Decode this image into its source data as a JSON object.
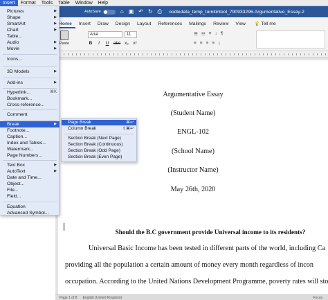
{
  "menubar": {
    "items": [
      "Insert",
      "Format",
      "Tools",
      "Table",
      "Window",
      "Help"
    ]
  },
  "titlebar": {
    "autosave_label": "AutoSave",
    "autosave_state": "OFF",
    "doc_title": "oodledata_temp_turnitintool_790933296.Argumentative_Essay-2"
  },
  "ribbon": {
    "tabs": [
      "Home",
      "Insert",
      "Draw",
      "Design",
      "Layout",
      "References",
      "Mailings",
      "Review",
      "View"
    ],
    "tell_me": "Tell me",
    "paste_label": "Paste",
    "font_name": "Arial",
    "font_size": "11",
    "format_buttons": [
      "B",
      "I",
      "U",
      "abc",
      "x₂",
      "x²"
    ]
  },
  "insert_menu": {
    "items": [
      {
        "label": "Pictures",
        "arrow": true
      },
      {
        "label": "Shape",
        "arrow": true
      },
      {
        "label": "SmartArt",
        "arrow": true
      },
      {
        "label": "Chart",
        "arrow": true
      },
      {
        "label": "Table...",
        "arrow": false
      },
      {
        "label": "Audio",
        "arrow": true
      },
      {
        "label": "Movie",
        "arrow": true
      },
      {
        "label": "Icons...",
        "arrow": false
      },
      {
        "label": "3D Models",
        "arrow": true
      },
      {
        "label": "Add-ins",
        "arrow": true
      },
      {
        "label": "Hyperlink...",
        "shortcut": "⌘K"
      },
      {
        "label": "Bookmark...",
        "arrow": false
      },
      {
        "label": "Cross-reference...",
        "arrow": false
      },
      {
        "label": "Comment",
        "arrow": false
      },
      {
        "label": "Break",
        "arrow": true
      },
      {
        "label": "Footnote...",
        "arrow": false
      },
      {
        "label": "Caption...",
        "arrow": false
      },
      {
        "label": "Index and Tables...",
        "arrow": false
      },
      {
        "label": "Watermark...",
        "arrow": false
      },
      {
        "label": "Page Numbers...",
        "arrow": false
      },
      {
        "label": "Text Box",
        "arrow": true
      },
      {
        "label": "AutoText",
        "arrow": true
      },
      {
        "label": "Date and Time...",
        "arrow": false
      },
      {
        "label": "Object...",
        "arrow": false
      },
      {
        "label": "File...",
        "arrow": false
      },
      {
        "label": "Field...",
        "arrow": false
      },
      {
        "label": "Equation",
        "arrow": false
      },
      {
        "label": "Advanced Symbol...",
        "arrow": false
      }
    ],
    "highlighted": "Break"
  },
  "break_submenu": {
    "items": [
      {
        "label": "Page Break",
        "shortcut": "⌘↩"
      },
      {
        "label": "Column Break",
        "shortcut": "⇧⌘↩"
      },
      {
        "label": "Section Break (Next Page)"
      },
      {
        "label": "Section Break (Continuous)"
      },
      {
        "label": "Section Break (Odd Page)"
      },
      {
        "label": "Section Break (Even Page)"
      }
    ],
    "highlighted": "Page Break"
  },
  "document": {
    "title_lines": [
      "Argumentative Essay",
      "(Student Name)",
      "ENGL-102",
      "(School Name)",
      "(Instructor Name)",
      "May 26th, 2020"
    ],
    "heading": "Should the B.C government provide Universal income to its residents?",
    "body_lines": [
      "Universal Basic Income has been tested in different parts of the world, including Ca",
      "providing all the population a certain amount of money every month regardless of incon",
      "occupation. According to the United Nations Development Programme, poverty rates will sto"
    ]
  },
  "statusbar": {
    "page": "Page 1 of 8",
    "words": "",
    "language": "English (United Kingdom)",
    "focus": "Focus"
  },
  "colors": {
    "word_blue": "#2b579a",
    "menu_highlight": "#2f62d3",
    "menu_bg": "#e2e9f7"
  }
}
